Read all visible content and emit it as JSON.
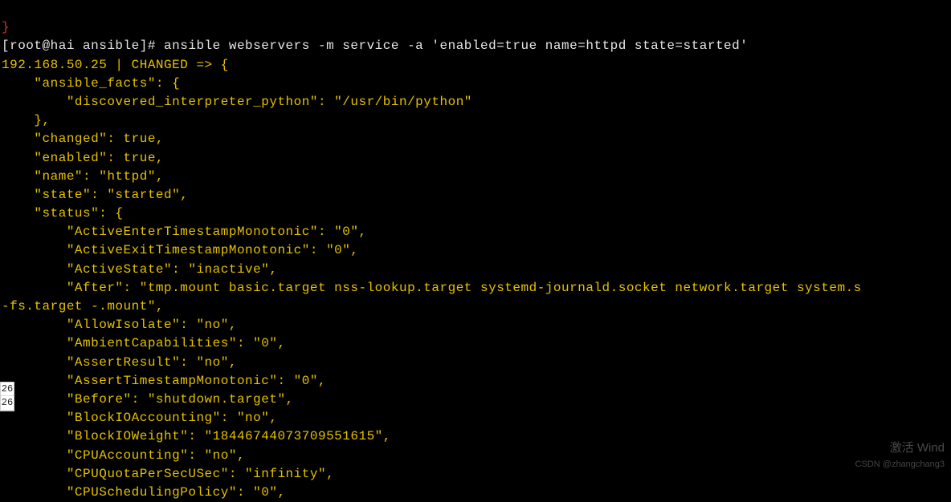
{
  "closing_brace": "}",
  "prompt": "[root@hai ansible]# ",
  "command": "ansible webservers -m service -a 'enabled=true name=httpd state=started'",
  "host_line": "192.168.50.25 | CHANGED => {",
  "lines": [
    "    \"ansible_facts\": {",
    "        \"discovered_interpreter_python\": \"/usr/bin/python\"",
    "    },",
    "    \"changed\": true,",
    "    \"enabled\": true,",
    "    \"name\": \"httpd\",",
    "    \"state\": \"started\",",
    "    \"status\": {",
    "        \"ActiveEnterTimestampMonotonic\": \"0\",",
    "        \"ActiveExitTimestampMonotonic\": \"0\",",
    "        \"ActiveState\": \"inactive\",",
    "        \"After\": \"tmp.mount basic.target nss-lookup.target systemd-journald.socket network.target system.s"
  ],
  "continuation": "-fs.target -.mount\",",
  "lines2": [
    "        \"AllowIsolate\": \"no\",",
    "        \"AmbientCapabilities\": \"0\",",
    "        \"AssertResult\": \"no\",",
    "        \"AssertTimestampMonotonic\": \"0\",",
    "        \"Before\": \"shutdown.target\",",
    "        \"BlockIOAccounting\": \"no\",",
    "        \"BlockIOWeight\": \"18446744073709551615\",",
    "        \"CPUAccounting\": \"no\",",
    "        \"CPUQuotaPerSecUSec\": \"infinity\",",
    "        \"CPUSchedulingPolicy\": \"0\","
  ],
  "side1": "26",
  "side2": "26",
  "watermark": "激活 Wind",
  "csdn": "CSDN @zhangchang3"
}
